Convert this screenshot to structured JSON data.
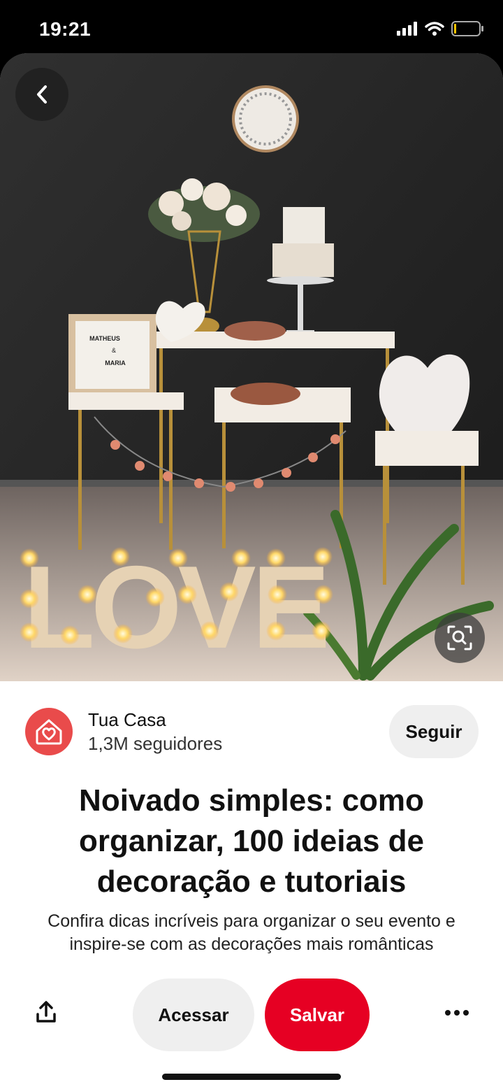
{
  "status_bar": {
    "time": "19:21",
    "icons": [
      "signal-icon",
      "wifi-icon",
      "battery-icon"
    ]
  },
  "hero": {
    "description_image": "decorated party table photo",
    "back_icon": "chevron-left-icon",
    "lens_icon": "visual-search-icon",
    "letterboard_lines": [
      "MATHEUS",
      "&",
      "MARIA"
    ],
    "marquee_letters": "LOVE"
  },
  "creator": {
    "name": "Tua Casa",
    "followers": "1,3M seguidores",
    "follow_label": "Seguir",
    "avatar_icon": "house-heart-icon",
    "avatar_color": "#e94b4b"
  },
  "pin": {
    "title": "Noivado simples: como organizar, 100 ideias de decoração e tutoriais",
    "description": "Confira dicas incríveis para organizar o seu evento e inspire-se com as decorações mais românticas"
  },
  "actions": {
    "share_icon": "share-icon",
    "visit_label": "Acessar",
    "save_label": "Salvar",
    "more_icon": "more-icon",
    "save_color": "#e60023"
  }
}
